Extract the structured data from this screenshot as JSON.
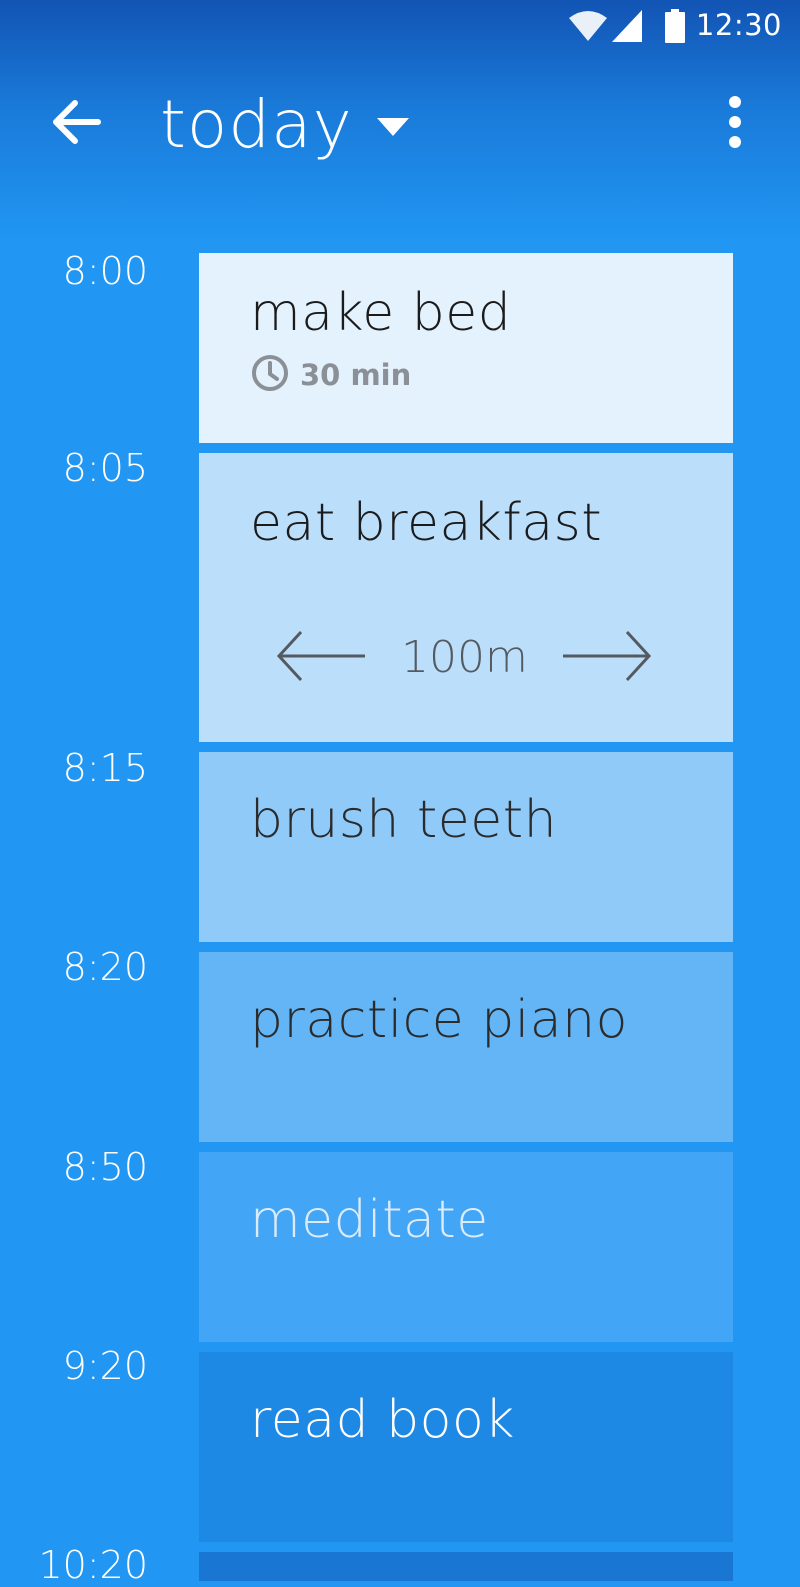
{
  "status_bar": {
    "time": "12:30",
    "icons": [
      "wifi-icon",
      "signal-icon",
      "battery-icon"
    ]
  },
  "app_bar": {
    "title": "today",
    "back_icon": "arrow-left-icon",
    "dropdown_icon": "caret-down-icon",
    "menu_icon": "more-vert-icon"
  },
  "schedule": [
    {
      "time": "8:00",
      "title": "make bed",
      "duration": "30 min",
      "duration_icon": "clock-icon",
      "color": "#E3F2FD",
      "text_color": "#1b1b1b"
    },
    {
      "time": "8:05",
      "title": "eat breakfast",
      "resize_value": "100m",
      "color": "#BBDEFB",
      "text_color": "#1b1b1b"
    },
    {
      "time": "8:15",
      "title": "brush teeth",
      "color": "#90CAF9",
      "text_color": "#2b2b2b"
    },
    {
      "time": "8:20",
      "title": "practice piano",
      "color": "#64B5F6",
      "text_color": "#2b2b2b"
    },
    {
      "time": "8:50",
      "title": "meditate",
      "color": "#42A5F5",
      "text_color": "#DCEBFA"
    },
    {
      "time": "9:20",
      "title": "read book",
      "color": "#1E88E5",
      "text_color": "#ffffff"
    },
    {
      "time": "10:20",
      "title": "",
      "color": "#1976D2",
      "text_color": "#ffffff"
    }
  ],
  "colors": {
    "background": "#2196F3",
    "header_top": "#1254B4"
  }
}
